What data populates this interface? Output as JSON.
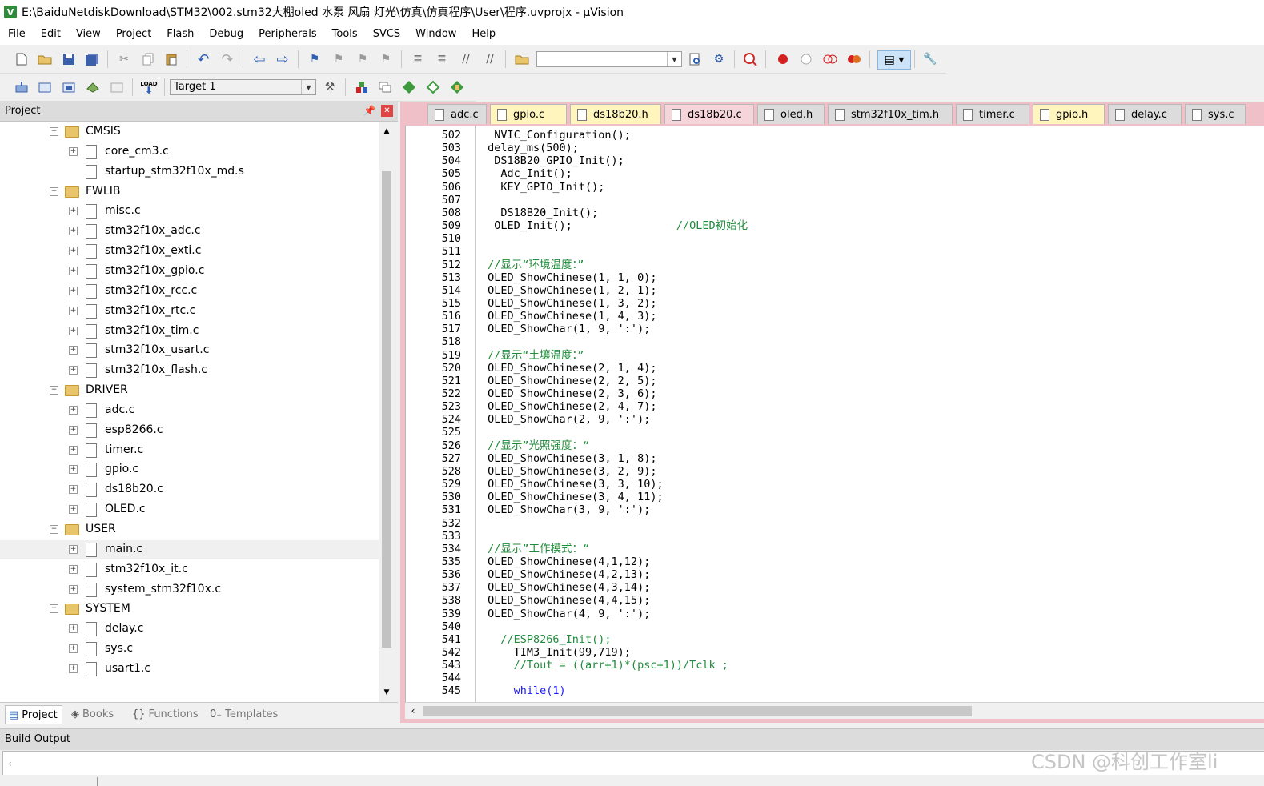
{
  "window": {
    "title": "E:\\BaiduNetdiskDownload\\STM32\\002.stm32大棚oled 水泵 风扇 灯光\\仿真\\仿真程序\\User\\程序.uvprojx - µVision"
  },
  "menu": [
    "File",
    "Edit",
    "View",
    "Project",
    "Flash",
    "Debug",
    "Peripherals",
    "Tools",
    "SVCS",
    "Window",
    "Help"
  ],
  "toolbar2": {
    "target": "Target 1"
  },
  "project_panel": {
    "title": "Project",
    "tree": [
      {
        "type": "folder",
        "depth": 0,
        "expanded": true,
        "label": "CMSIS"
      },
      {
        "type": "file",
        "depth": 1,
        "exp": true,
        "label": "core_cm3.c"
      },
      {
        "type": "file",
        "depth": 1,
        "exp": false,
        "label": "startup_stm32f10x_md.s"
      },
      {
        "type": "folder",
        "depth": 0,
        "expanded": true,
        "label": "FWLIB"
      },
      {
        "type": "file",
        "depth": 1,
        "exp": true,
        "label": "misc.c"
      },
      {
        "type": "file",
        "depth": 1,
        "exp": true,
        "label": "stm32f10x_adc.c"
      },
      {
        "type": "file",
        "depth": 1,
        "exp": true,
        "label": "stm32f10x_exti.c"
      },
      {
        "type": "file",
        "depth": 1,
        "exp": true,
        "label": "stm32f10x_gpio.c"
      },
      {
        "type": "file",
        "depth": 1,
        "exp": true,
        "label": "stm32f10x_rcc.c"
      },
      {
        "type": "file",
        "depth": 1,
        "exp": true,
        "label": "stm32f10x_rtc.c"
      },
      {
        "type": "file",
        "depth": 1,
        "exp": true,
        "label": "stm32f10x_tim.c"
      },
      {
        "type": "file",
        "depth": 1,
        "exp": true,
        "label": "stm32f10x_usart.c"
      },
      {
        "type": "file",
        "depth": 1,
        "exp": true,
        "label": "stm32f10x_flash.c"
      },
      {
        "type": "folder",
        "depth": 0,
        "expanded": true,
        "label": "DRIVER"
      },
      {
        "type": "file",
        "depth": 1,
        "exp": true,
        "label": "adc.c"
      },
      {
        "type": "file",
        "depth": 1,
        "exp": true,
        "label": "esp8266.c"
      },
      {
        "type": "file",
        "depth": 1,
        "exp": true,
        "label": "timer.c"
      },
      {
        "type": "file",
        "depth": 1,
        "exp": true,
        "label": "gpio.c"
      },
      {
        "type": "file",
        "depth": 1,
        "exp": true,
        "label": "ds18b20.c"
      },
      {
        "type": "file",
        "depth": 1,
        "exp": true,
        "label": "OLED.c"
      },
      {
        "type": "folder",
        "depth": 0,
        "expanded": true,
        "label": "USER"
      },
      {
        "type": "file",
        "depth": 1,
        "exp": true,
        "label": "main.c",
        "selected": true
      },
      {
        "type": "file",
        "depth": 1,
        "exp": true,
        "label": "stm32f10x_it.c"
      },
      {
        "type": "file",
        "depth": 1,
        "exp": true,
        "label": "system_stm32f10x.c"
      },
      {
        "type": "folder",
        "depth": 0,
        "expanded": true,
        "label": "SYSTEM"
      },
      {
        "type": "file",
        "depth": 1,
        "exp": true,
        "label": "delay.c"
      },
      {
        "type": "file",
        "depth": 1,
        "exp": true,
        "label": "sys.c"
      },
      {
        "type": "file",
        "depth": 1,
        "exp": true,
        "label": "usart1.c"
      }
    ],
    "tabs": [
      {
        "label": "Project",
        "icon": "project-icon",
        "active": true
      },
      {
        "label": "Books",
        "icon": "books-icon",
        "active": false
      },
      {
        "label": "Functions",
        "icon": "functions-icon",
        "active": false
      },
      {
        "label": "Templates",
        "icon": "templates-icon",
        "active": false
      }
    ]
  },
  "editor_tabs": [
    {
      "label": "adc.c",
      "style": "gray"
    },
    {
      "label": "gpio.c",
      "style": "yellow"
    },
    {
      "label": "ds18b20.h",
      "style": "yellow"
    },
    {
      "label": "ds18b20.c",
      "style": "pink"
    },
    {
      "label": "oled.h",
      "style": "gray"
    },
    {
      "label": "stm32f10x_tim.h",
      "style": "gray"
    },
    {
      "label": "timer.c",
      "style": "gray"
    },
    {
      "label": "gpio.h",
      "style": "yellow"
    },
    {
      "label": "delay.c",
      "style": "gray"
    },
    {
      "label": "sys.c",
      "style": "gray"
    }
  ],
  "code_lines": [
    {
      "n": "502",
      "t": "  NVIC_Configuration();",
      "k": "n"
    },
    {
      "n": "503",
      "t": " delay_ms(500);",
      "k": "n"
    },
    {
      "n": "504",
      "t": "  DS18B20_GPIO_Init();",
      "k": "n"
    },
    {
      "n": "505",
      "t": "   Adc_Init();",
      "k": "n"
    },
    {
      "n": "506",
      "t": "   KEY_GPIO_Init();",
      "k": "n"
    },
    {
      "n": "507",
      "t": "",
      "k": "n"
    },
    {
      "n": "508",
      "t": "   DS18B20_Init();",
      "k": "n"
    },
    {
      "n": "509",
      "t": "  OLED_Init();",
      "k": "n",
      "c": "                //OLED初始化"
    },
    {
      "n": "510",
      "t": "",
      "k": "n"
    },
    {
      "n": "511",
      "t": "",
      "k": "n"
    },
    {
      "n": "512",
      "t": " //显示“环境温度：”",
      "k": "c"
    },
    {
      "n": "513",
      "t": " OLED_ShowChinese(1, 1, 0);",
      "k": "n"
    },
    {
      "n": "514",
      "t": " OLED_ShowChinese(1, 2, 1);",
      "k": "n"
    },
    {
      "n": "515",
      "t": " OLED_ShowChinese(1, 3, 2);",
      "k": "n"
    },
    {
      "n": "516",
      "t": " OLED_ShowChinese(1, 4, 3);",
      "k": "n"
    },
    {
      "n": "517",
      "t": " OLED_ShowChar(1, 9, ':');",
      "k": "n"
    },
    {
      "n": "518",
      "t": "",
      "k": "n"
    },
    {
      "n": "519",
      "t": " //显示“土壤温度：”",
      "k": "c"
    },
    {
      "n": "520",
      "t": " OLED_ShowChinese(2, 1, 4);",
      "k": "n"
    },
    {
      "n": "521",
      "t": " OLED_ShowChinese(2, 2, 5);",
      "k": "n"
    },
    {
      "n": "522",
      "t": " OLED_ShowChinese(2, 3, 6);",
      "k": "n"
    },
    {
      "n": "523",
      "t": " OLED_ShowChinese(2, 4, 7);",
      "k": "n"
    },
    {
      "n": "524",
      "t": " OLED_ShowChar(2, 9, ':');",
      "k": "n"
    },
    {
      "n": "525",
      "t": "",
      "k": "n"
    },
    {
      "n": "526",
      "t": " //显示”光照强度：“",
      "k": "c"
    },
    {
      "n": "527",
      "t": " OLED_ShowChinese(3, 1, 8);",
      "k": "n"
    },
    {
      "n": "528",
      "t": " OLED_ShowChinese(3, 2, 9);",
      "k": "n"
    },
    {
      "n": "529",
      "t": " OLED_ShowChinese(3, 3, 10);",
      "k": "n"
    },
    {
      "n": "530",
      "t": " OLED_ShowChinese(3, 4, 11);",
      "k": "n"
    },
    {
      "n": "531",
      "t": " OLED_ShowChar(3, 9, ':');",
      "k": "n"
    },
    {
      "n": "532",
      "t": "",
      "k": "n"
    },
    {
      "n": "533",
      "t": "",
      "k": "n"
    },
    {
      "n": "534",
      "t": " //显示”工作模式：“",
      "k": "c"
    },
    {
      "n": "535",
      "t": " OLED_ShowChinese(4,1,12);",
      "k": "n"
    },
    {
      "n": "536",
      "t": " OLED_ShowChinese(4,2,13);",
      "k": "n"
    },
    {
      "n": "537",
      "t": " OLED_ShowChinese(4,3,14);",
      "k": "n"
    },
    {
      "n": "538",
      "t": " OLED_ShowChinese(4,4,15);",
      "k": "n"
    },
    {
      "n": "539",
      "t": " OLED_ShowChar(4, 9, ':');",
      "k": "n"
    },
    {
      "n": "540",
      "t": "",
      "k": "n"
    },
    {
      "n": "541",
      "t": "   //ESP8266_Init();",
      "k": "c"
    },
    {
      "n": "542",
      "t": "     TIM3_Init(99,719);",
      "k": "n"
    },
    {
      "n": "543",
      "t": "     //Tout = ((arr+1)*(psc+1))/Tclk ;",
      "k": "c"
    },
    {
      "n": "544",
      "t": "",
      "k": "n"
    },
    {
      "n": "545",
      "t": "     while(1)",
      "k": "w"
    }
  ],
  "build_output": {
    "title": "Build Output"
  },
  "watermark": "CSDN @科创工作室li"
}
